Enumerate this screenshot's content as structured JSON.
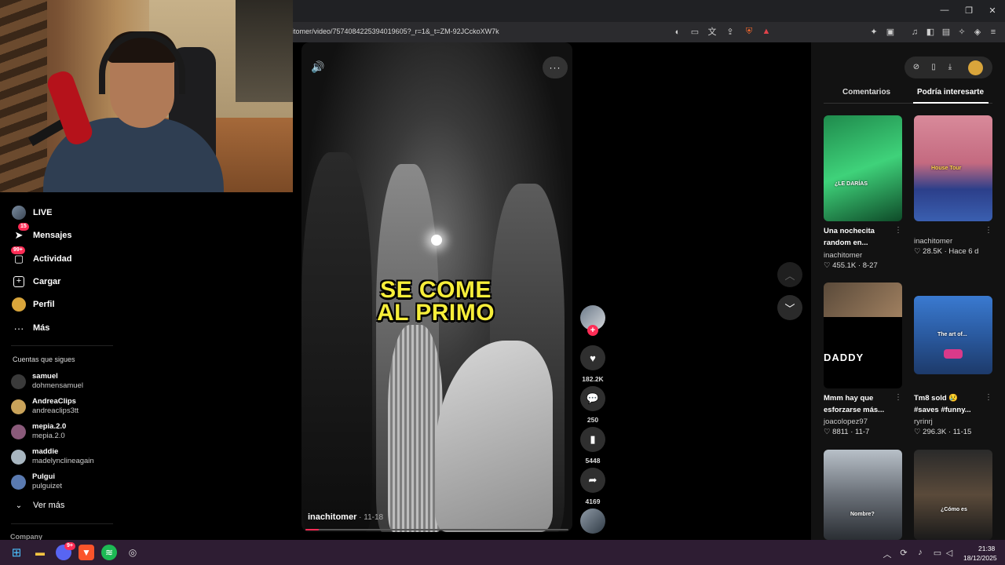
{
  "browser": {
    "url": "itomer/video/7574084225394019605?_r=1&_t=ZM-92JCckoXW7k",
    "window_controls": [
      "—",
      "❐",
      "✕"
    ]
  },
  "sidebar": {
    "items": [
      {
        "label": "LIVE",
        "icon": "live-icon"
      },
      {
        "label": "Mensajes",
        "icon": "messages-icon",
        "badge": "15"
      },
      {
        "label": "Actividad",
        "icon": "activity-icon",
        "badge": "99+"
      },
      {
        "label": "Cargar",
        "icon": "upload-icon"
      },
      {
        "label": "Perfil",
        "icon": "profile-icon"
      },
      {
        "label": "Más",
        "icon": "more-icon"
      }
    ],
    "following_title": "Cuentas que sigues",
    "following": [
      {
        "name": "samuel",
        "handle": "dohmensamuel",
        "color": "#3a3a3a"
      },
      {
        "name": "AndreaClips",
        "handle": "andreaclips3tt",
        "color": "#c9a35a"
      },
      {
        "name": "mepia.2.0",
        "handle": "mepia.2.0",
        "color": "#8a5a7a"
      },
      {
        "name": "maddie",
        "handle": "madelynclineagain",
        "color": "#a8b6c0"
      },
      {
        "name": "Pulgui",
        "handle": "pulguizet",
        "color": "#5a7ab0"
      }
    ],
    "see_more": "Ver más",
    "company": "Company"
  },
  "video": {
    "caption_line1": "SE COME",
    "caption_line2": "AL PRIMO",
    "author": "inachitomer",
    "date": " · 11-18",
    "progress": 0.05
  },
  "actions": {
    "likes": "182.2K",
    "comments": "250",
    "saves": "5448",
    "shares": "4169"
  },
  "right_panel": {
    "tabs": [
      "Comentarios",
      "Podría interesarte"
    ],
    "active_tab": "Podría interesarte",
    "videos": [
      {
        "title": "Una nochecita random en...",
        "author": "inachitomer",
        "stats": "♡ 455.1K · 8-27",
        "overlay": "¿LE DARÍAS"
      },
      {
        "title": "",
        "author": "inachitomer",
        "stats": "♡ 28.5K · Hace 6 d",
        "overlay": "House Tour"
      },
      {
        "title": "Mmm hay que esforzarse más...",
        "author": "joacolopez97",
        "stats": "♡ 8811 · 11-7",
        "overlay": "DADDY"
      },
      {
        "title": "Tm8 sold 😢 #saves #funny...",
        "author": "ryrinrj",
        "stats": "♡ 296.3K · 11-15",
        "overlay": "The art of..."
      },
      {
        "title": "",
        "author": "",
        "stats": "",
        "overlay": "Nombre?"
      },
      {
        "title": "",
        "author": "",
        "stats": "",
        "overlay": "¿Cómo es"
      }
    ]
  },
  "taskbar": {
    "time": "21:38",
    "date": "18/12/2025",
    "discord_badge": "9+"
  },
  "colors": {
    "accent": "#fe2c55",
    "caption": "#f6ee3a",
    "taskbar": "#2e1d33"
  }
}
